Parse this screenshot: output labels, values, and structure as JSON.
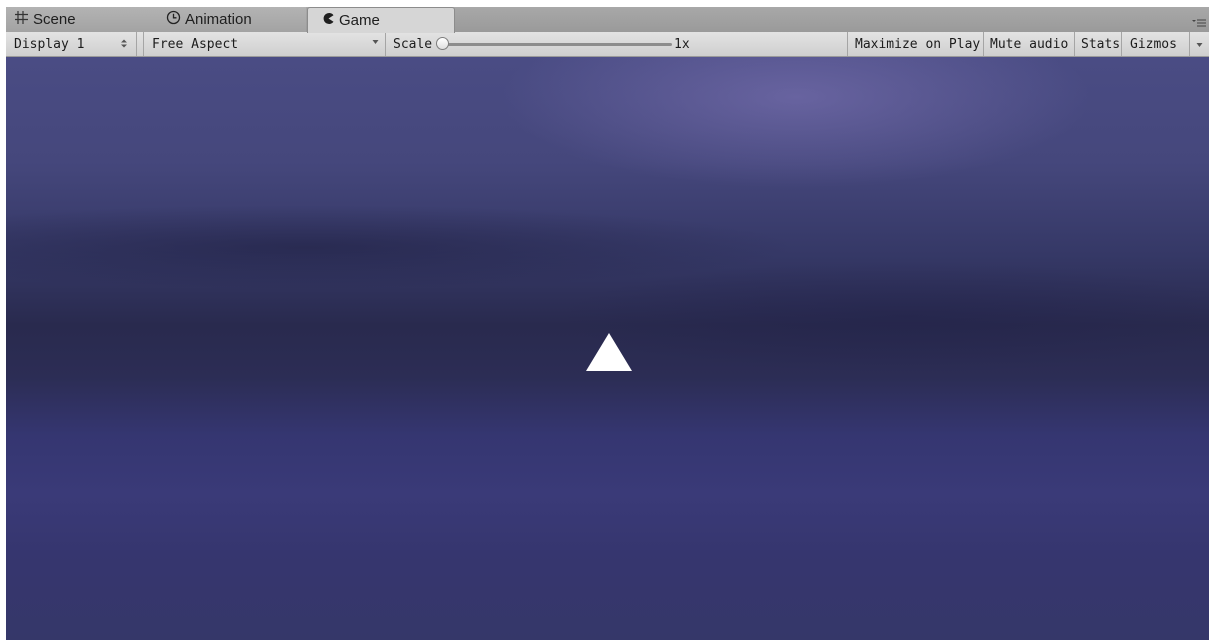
{
  "tabs": [
    {
      "label": "Scene",
      "icon": "hash-grid-icon",
      "glyph": "#"
    },
    {
      "label": "Animation",
      "icon": "clock-icon",
      "glyph": "◴"
    },
    {
      "label": "Game",
      "icon": "pacman-icon",
      "glyph": "◖"
    }
  ],
  "toolbar": {
    "display": "Display 1",
    "aspect": "Free Aspect",
    "scale_label": "Scale",
    "scale_value": "1x",
    "maximize_on_play": "Maximize on Play",
    "mute_audio": "Mute audio",
    "stats": "Stats",
    "gizmos": "Gizmos"
  },
  "game_view": {
    "background_color": "#353769",
    "sprite": {
      "shape": "triangle",
      "color": "#ffffff"
    }
  },
  "colors": {
    "tab_active_bg": "#d6d6d6",
    "toolbar_bg": "#d9d9d9"
  }
}
